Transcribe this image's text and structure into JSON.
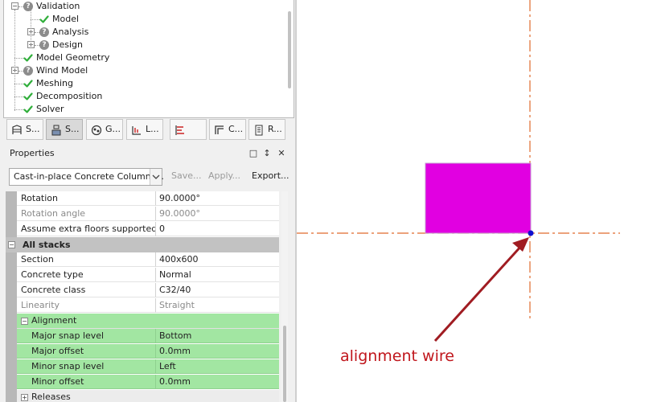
{
  "tree": {
    "items": [
      {
        "label": "Validation",
        "status": "question",
        "expander": "minus"
      },
      {
        "label": "Model",
        "status": "check",
        "expander": ""
      },
      {
        "label": "Analysis",
        "status": "question",
        "expander": "plus"
      },
      {
        "label": "Design",
        "status": "question",
        "expander": "plus"
      },
      {
        "label": "Model Geometry",
        "status": "check",
        "expander": ""
      },
      {
        "label": "Wind Model",
        "status": "question",
        "expander": "plus"
      },
      {
        "label": "Meshing",
        "status": "check",
        "expander": ""
      },
      {
        "label": "Decomposition",
        "status": "check",
        "expander": ""
      },
      {
        "label": "Solver",
        "status": "check",
        "expander": ""
      }
    ]
  },
  "tabs": [
    {
      "label": "S...",
      "icon": "structure-icon",
      "active": false
    },
    {
      "label": "S...",
      "icon": "scene-icon",
      "active": true
    },
    {
      "label": "G...",
      "icon": "groups-icon",
      "active": false
    },
    {
      "label": "L...",
      "icon": "loading-icon",
      "active": false
    },
    {
      "label": "",
      "icon": "levels-icon",
      "active": false
    },
    {
      "label": "C...",
      "icon": "cross-section-icon",
      "active": false
    },
    {
      "label": "R...",
      "icon": "report-icon",
      "active": false
    }
  ],
  "properties": {
    "title": "Properties",
    "header_icons": [
      "□",
      "↕",
      "✕"
    ],
    "type_select": "Cast-in-place Concrete Columns...",
    "save_label": "Save...",
    "apply_label": "Apply...",
    "export_label": "Export..."
  },
  "grid": {
    "rows": [
      {
        "kind": "prop",
        "name": "Rotation",
        "value": "90.0000°",
        "style": ""
      },
      {
        "kind": "prop",
        "name": "Rotation angle",
        "value": "90.0000°",
        "style": "grey"
      },
      {
        "kind": "prop",
        "name": "Assume extra floors supported",
        "value": "0",
        "style": ""
      },
      {
        "kind": "cat",
        "name": "All stacks",
        "value": "",
        "style": ""
      },
      {
        "kind": "prop",
        "name": "Section",
        "value": "400x600",
        "style": ""
      },
      {
        "kind": "prop",
        "name": "Concrete type",
        "value": "Normal",
        "style": ""
      },
      {
        "kind": "prop",
        "name": "Concrete class",
        "value": "C32/40",
        "style": ""
      },
      {
        "kind": "prop",
        "name": "Linearity",
        "value": "Straight",
        "style": "grey"
      },
      {
        "kind": "subcat",
        "name": "Alignment",
        "value": "",
        "style": "green",
        "expander": "minus"
      },
      {
        "kind": "prop",
        "name": "Major snap level",
        "value": "Bottom",
        "style": "green"
      },
      {
        "kind": "prop",
        "name": "Major offset",
        "value": "0.0mm",
        "style": "green"
      },
      {
        "kind": "prop",
        "name": "Minor snap level",
        "value": "Left",
        "style": "green"
      },
      {
        "kind": "prop",
        "name": "Minor offset",
        "value": "0.0mm",
        "style": "green"
      },
      {
        "kind": "subcat",
        "name": "Releases",
        "value": "",
        "style": "",
        "expander": "plus"
      }
    ]
  },
  "canvas": {
    "annotation": "alignment wire",
    "colors": {
      "column_fill": "#e100e1",
      "column_stroke": "#c39ad0",
      "grid_line": "#e06a2c",
      "snap_point": "#1010d0",
      "arrow": "#a01c22",
      "annotation_text": "#c0161c"
    }
  }
}
